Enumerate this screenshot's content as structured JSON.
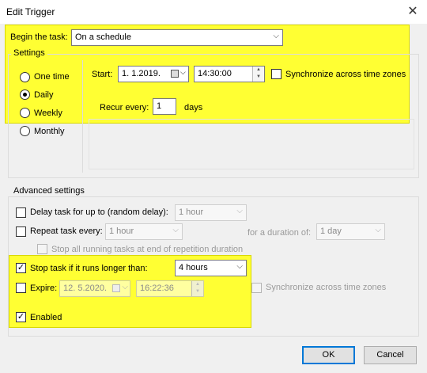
{
  "window": {
    "title": "Edit Trigger",
    "close_glyph": "✕"
  },
  "begin_task": {
    "label": "Begin the task:",
    "value": "On a schedule"
  },
  "settings": {
    "label": "Settings",
    "schedule_options": [
      {
        "label": "One time",
        "selected": false
      },
      {
        "label": "Daily",
        "selected": true
      },
      {
        "label": "Weekly",
        "selected": false
      },
      {
        "label": "Monthly",
        "selected": false
      }
    ],
    "start_label": "Start:",
    "start_date": "1. 1.2019.",
    "start_time": "14:30:00",
    "sync_label": "Synchronize across time zones",
    "recur_label": "Recur every:",
    "recur_value": "1",
    "recur_unit": "days"
  },
  "advanced": {
    "label": "Advanced settings",
    "delay_label": "Delay task for up to (random delay):",
    "delay_value": "1 hour",
    "repeat_label": "Repeat task every:",
    "repeat_value": "1 hour",
    "duration_label": "for a duration of:",
    "duration_value": "1 day",
    "stop_all_label": "Stop all running tasks at end of repetition duration",
    "stop_if_label": "Stop task if it runs longer than:",
    "stop_if_value": "4 hours",
    "expire_label": "Expire:",
    "expire_date": "12.  5.2020.",
    "expire_time": "16:22:36",
    "expire_sync_label": "Synchronize across time zones",
    "enabled_label": "Enabled"
  },
  "buttons": {
    "ok": "OK",
    "cancel": "Cancel"
  },
  "colors": {
    "highlight": "#ffff33",
    "accent": "#0078d7"
  },
  "icons": {
    "checked": "✓",
    "dropdown": "⌵",
    "spin_up": "▲",
    "spin_down": "▼"
  }
}
